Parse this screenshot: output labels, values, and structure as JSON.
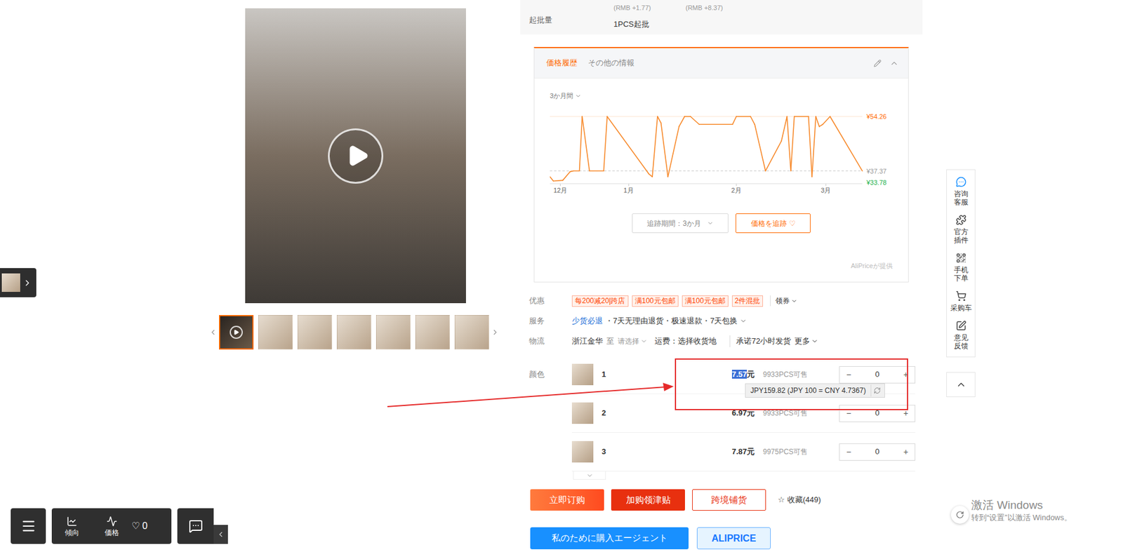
{
  "gallery": {
    "thumbnails": [
      {
        "kind": "video",
        "selected": true
      },
      {
        "kind": "image",
        "selected": false
      },
      {
        "kind": "image",
        "selected": false
      },
      {
        "kind": "image",
        "selected": false
      },
      {
        "kind": "image",
        "selected": false
      },
      {
        "kind": "image",
        "selected": false
      },
      {
        "kind": "image",
        "selected": false
      }
    ]
  },
  "moq": {
    "label": "起批量",
    "price_notes": [
      "(RMB +1.77)",
      "(RMB +8.37)"
    ],
    "value": "1PCS起批"
  },
  "price_history": {
    "tabs": [
      {
        "label": "価格履歴",
        "selected": true
      },
      {
        "label": "その他の情報",
        "selected": false
      }
    ],
    "range": "3か月間",
    "y_labels": [
      {
        "text": "¥54.26",
        "value": 54.26,
        "color": "#ff6a00",
        "kind": "max"
      },
      {
        "text": "¥37.37",
        "value": 37.37,
        "color": "#999999",
        "kind": "current"
      },
      {
        "text": "¥33.78",
        "value": 33.78,
        "color": "#22b14c",
        "kind": "min"
      }
    ],
    "x_labels": [
      {
        "text": "12月",
        "day": 3
      },
      {
        "text": "1月",
        "day": 22.7
      },
      {
        "text": "2月",
        "day": 53.7
      },
      {
        "text": "3月",
        "day": 79.5
      }
    ],
    "series": {
      "days": [
        0,
        1,
        3.7,
        5.8,
        6.8,
        8.5,
        9.3,
        11.4,
        15.5,
        16.5,
        28.5,
        29.5,
        31,
        32,
        34,
        37.2,
        38.8,
        40.5,
        43,
        52.6,
        53.7,
        57.8,
        59,
        62.1,
        66.7,
        68.3,
        69.4,
        70.4,
        74.5,
        75.5,
        76.6,
        77.6,
        78.6,
        80.7,
        90
      ],
      "prices": [
        35.56,
        34.23,
        34.45,
        37.12,
        37.37,
        37.37,
        54.26,
        37.37,
        37.37,
        54.26,
        36.45,
        35.56,
        54.26,
        52.26,
        35.56,
        51.14,
        54.26,
        54.26,
        51.81,
        51.81,
        54.26,
        54.26,
        51.81,
        37.37,
        46.69,
        54.26,
        37.37,
        54.26,
        54.26,
        35.56,
        54.26,
        51.14,
        51.81,
        54.26,
        37.37
      ]
    },
    "period_button": "追跡期間：3か月",
    "track_button": "価格を追跡",
    "track_icon": "♡",
    "credit": "AliPriceが提供"
  },
  "offers": {
    "label": "优惠",
    "tags": [
      "每200减20|跨店",
      "满100元包邮",
      "满100元包邮",
      "2件混批"
    ],
    "coupon": "领券"
  },
  "services": {
    "label": "服务",
    "separator": "・",
    "items": [
      {
        "text": "少货必退",
        "highlighted": true
      },
      {
        "text": "7天无理由退货",
        "highlighted": false
      },
      {
        "text": "极速退款",
        "highlighted": false
      },
      {
        "text": "7天包换",
        "highlighted": false
      }
    ]
  },
  "logistics": {
    "label": "物流",
    "origin": "浙江金华",
    "to": "至",
    "destination": "请选择",
    "shipping": "运费：选择收货地",
    "promise": "承诺72小时发货",
    "more": "更多"
  },
  "variants": {
    "label": "颜色",
    "minus": "−",
    "plus": "+",
    "rows": [
      {
        "name": "1",
        "price": "7.57",
        "unit": "元",
        "stock": "9933PCS可售",
        "quantity": "0",
        "highlighted": true
      },
      {
        "name": "2",
        "price": "6.97",
        "unit": "元",
        "stock": "9933PCS可售",
        "quantity": "0",
        "highlighted": false
      },
      {
        "name": "3",
        "price": "7.87",
        "unit": "元",
        "stock": "9975PCS可售",
        "quantity": "0",
        "highlighted": false
      }
    ],
    "tooltip": "JPY159.82 (JPY 100 = CNY 4.7367)"
  },
  "actions": [
    {
      "label": "立即订购",
      "kind": "primary"
    },
    {
      "label": "加购领津贴",
      "kind": "danger"
    },
    {
      "label": "跨境铺货",
      "kind": "outline"
    }
  ],
  "favorite": {
    "icon": "☆",
    "label": "收藏(449)"
  },
  "agent": {
    "button": "私のために購入エージェント",
    "brand": "ALIPRICE"
  },
  "sidebar": {
    "items": [
      {
        "lines": [
          "咨询",
          "客服"
        ]
      },
      {
        "lines": [
          "官方",
          "插件"
        ]
      },
      {
        "lines": [
          "手机",
          "下单"
        ]
      },
      {
        "lines": [
          "采购车"
        ]
      },
      {
        "lines": [
          "意见",
          "反馈"
        ]
      }
    ]
  },
  "toolbar": {
    "items": [
      {
        "label": "傾向"
      },
      {
        "label": "価格"
      }
    ],
    "heart": "♡",
    "likes": "0"
  },
  "watermark": {
    "title": "激活 Windows",
    "subtitle": "转到“设置”以激活 Windows。"
  }
}
